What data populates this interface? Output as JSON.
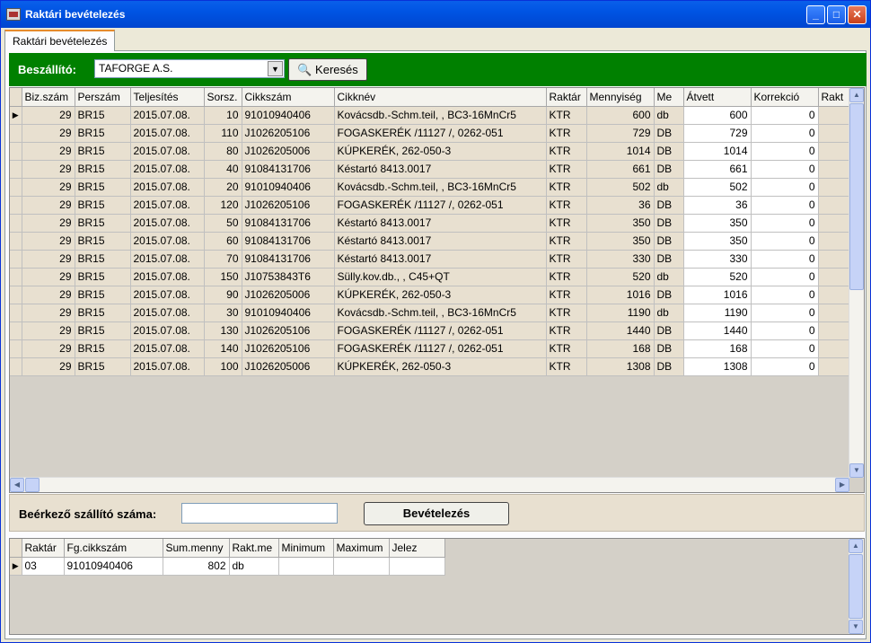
{
  "window": {
    "title": "Raktári bevételezés"
  },
  "tab": {
    "label": "Raktári bevételezés"
  },
  "filter": {
    "supplier_label": "Beszállító:",
    "supplier_value": "TAFORGE A.S.",
    "search_label": "Keresés"
  },
  "grid": {
    "columns": [
      "Biz.szám",
      "Perszám",
      "Teljesítés",
      "Sorsz.",
      "Cikkszám",
      "Cikknév",
      "Raktár",
      "Mennyiség",
      "Me",
      "Átvett",
      "Korrekció",
      "Rakt"
    ],
    "rows": [
      [
        "29",
        "BR15",
        "2015.07.08.",
        "10",
        "91010940406",
        "Kovácsdb.-Schm.teil, , BC3-16MnCr5",
        "KTR",
        "600",
        "db",
        "600",
        "0"
      ],
      [
        "29",
        "BR15",
        "2015.07.08.",
        "110",
        "J1026205106",
        "FOGASKERÉK /11127 /, 0262-051",
        "KTR",
        "729",
        "DB",
        "729",
        "0"
      ],
      [
        "29",
        "BR15",
        "2015.07.08.",
        "80",
        "J1026205006",
        "KÚPKERÉK, 262-050-3",
        "KTR",
        "1014",
        "DB",
        "1014",
        "0"
      ],
      [
        "29",
        "BR15",
        "2015.07.08.",
        "40",
        "91084131706",
        "Késtartó 8413.0017",
        "KTR",
        "661",
        "DB",
        "661",
        "0"
      ],
      [
        "29",
        "BR15",
        "2015.07.08.",
        "20",
        "91010940406",
        "Kovácsdb.-Schm.teil, , BC3-16MnCr5",
        "KTR",
        "502",
        "db",
        "502",
        "0"
      ],
      [
        "29",
        "BR15",
        "2015.07.08.",
        "120",
        "J1026205106",
        "FOGASKERÉK /11127 /, 0262-051",
        "KTR",
        "36",
        "DB",
        "36",
        "0"
      ],
      [
        "29",
        "BR15",
        "2015.07.08.",
        "50",
        "91084131706",
        "Késtartó 8413.0017",
        "KTR",
        "350",
        "DB",
        "350",
        "0"
      ],
      [
        "29",
        "BR15",
        "2015.07.08.",
        "60",
        "91084131706",
        "Késtartó 8413.0017",
        "KTR",
        "350",
        "DB",
        "350",
        "0"
      ],
      [
        "29",
        "BR15",
        "2015.07.08.",
        "70",
        "91084131706",
        "Késtartó 8413.0017",
        "KTR",
        "330",
        "DB",
        "330",
        "0"
      ],
      [
        "29",
        "BR15",
        "2015.07.08.",
        "150",
        "J10753843T6",
        "Sülly.kov.db., , C45+QT",
        "KTR",
        "520",
        "db",
        "520",
        "0"
      ],
      [
        "29",
        "BR15",
        "2015.07.08.",
        "90",
        "J1026205006",
        "KÚPKERÉK, 262-050-3",
        "KTR",
        "1016",
        "DB",
        "1016",
        "0"
      ],
      [
        "29",
        "BR15",
        "2015.07.08.",
        "30",
        "91010940406",
        "Kovácsdb.-Schm.teil, , BC3-16MnCr5",
        "KTR",
        "1190",
        "db",
        "1190",
        "0"
      ],
      [
        "29",
        "BR15",
        "2015.07.08.",
        "130",
        "J1026205106",
        "FOGASKERÉK /11127 /, 0262-051",
        "KTR",
        "1440",
        "DB",
        "1440",
        "0"
      ],
      [
        "29",
        "BR15",
        "2015.07.08.",
        "140",
        "J1026205106",
        "FOGASKERÉK /11127 /, 0262-051",
        "KTR",
        "168",
        "DB",
        "168",
        "0"
      ],
      [
        "29",
        "BR15",
        "2015.07.08.",
        "100",
        "J1026205006",
        "KÚPKERÉK, 262-050-3",
        "KTR",
        "1308",
        "DB",
        "1308",
        "0"
      ]
    ]
  },
  "receive": {
    "label": "Beérkező szállító száma:",
    "input_value": "",
    "button_label": "Bevételezés"
  },
  "summary": {
    "columns": [
      "Raktár",
      "Fg.cikkszám",
      "Sum.menny",
      "Rakt.me",
      "Minimum",
      "Maximum",
      "Jelez"
    ],
    "rows": [
      [
        "03",
        "91010940406",
        "802",
        "db",
        "",
        "",
        ""
      ]
    ]
  }
}
